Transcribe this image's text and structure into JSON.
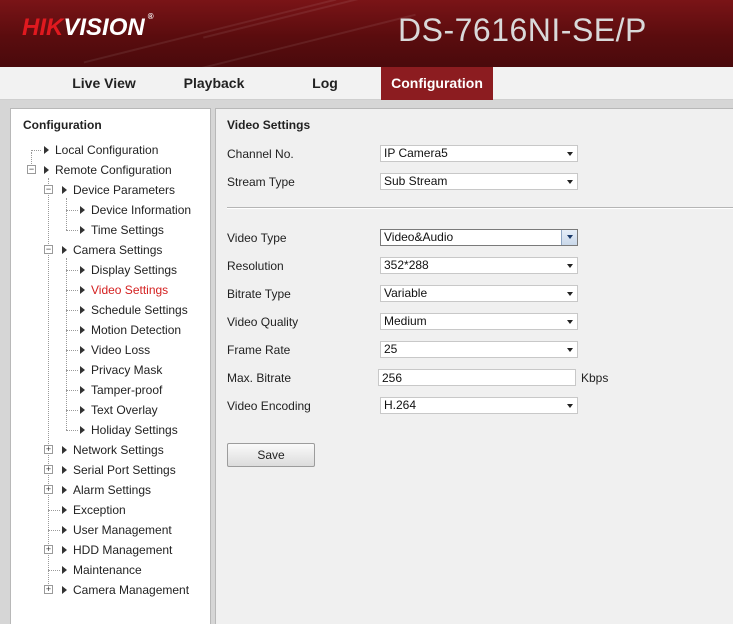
{
  "header": {
    "logo_part1": "HIK",
    "logo_part2": "VISION",
    "logo_tm": "®",
    "model": "DS-7616NI-SE/P"
  },
  "nav": {
    "tabs": [
      {
        "label": "Live View"
      },
      {
        "label": "Playback"
      },
      {
        "label": "Log"
      },
      {
        "label": "Configuration",
        "active": true
      }
    ]
  },
  "sidebar": {
    "title": "Configuration",
    "items": [
      {
        "label": "Local Configuration"
      },
      {
        "label": "Remote Configuration"
      },
      {
        "label": "Device Parameters"
      },
      {
        "label": "Device Information"
      },
      {
        "label": "Time Settings"
      },
      {
        "label": "Camera Settings"
      },
      {
        "label": "Display Settings"
      },
      {
        "label": "Video Settings",
        "selected": true
      },
      {
        "label": "Schedule Settings"
      },
      {
        "label": "Motion Detection"
      },
      {
        "label": "Video Loss"
      },
      {
        "label": "Privacy Mask"
      },
      {
        "label": "Tamper-proof"
      },
      {
        "label": "Text Overlay"
      },
      {
        "label": "Holiday Settings"
      },
      {
        "label": "Network Settings"
      },
      {
        "label": "Serial Port Settings"
      },
      {
        "label": "Alarm Settings"
      },
      {
        "label": "Exception"
      },
      {
        "label": "User Management"
      },
      {
        "label": "HDD Management"
      },
      {
        "label": "Maintenance"
      },
      {
        "label": "Camera Management"
      }
    ],
    "expander_minus": "−",
    "expander_plus": "+"
  },
  "main": {
    "title": "Video Settings",
    "channel_label": "Channel No.",
    "channel_value": "IP Camera5",
    "stream_type_label": "Stream Type",
    "stream_type_value": "Sub Stream",
    "video_type_label": "Video Type",
    "video_type_value": "Video&Audio",
    "resolution_label": "Resolution",
    "resolution_value": "352*288",
    "bitrate_type_label": "Bitrate Type",
    "bitrate_type_value": "Variable",
    "video_quality_label": "Video Quality",
    "video_quality_value": "Medium",
    "frame_rate_label": "Frame Rate",
    "frame_rate_value": "25",
    "max_bitrate_label": "Max. Bitrate",
    "max_bitrate_value": "256",
    "max_bitrate_unit": "Kbps",
    "video_encoding_label": "Video Encoding",
    "video_encoding_value": "H.264",
    "save_label": "Save"
  },
  "colors": {
    "brand_red": "#8c1c20",
    "logo_red": "#e0191f",
    "selected_item": "#d42020"
  }
}
